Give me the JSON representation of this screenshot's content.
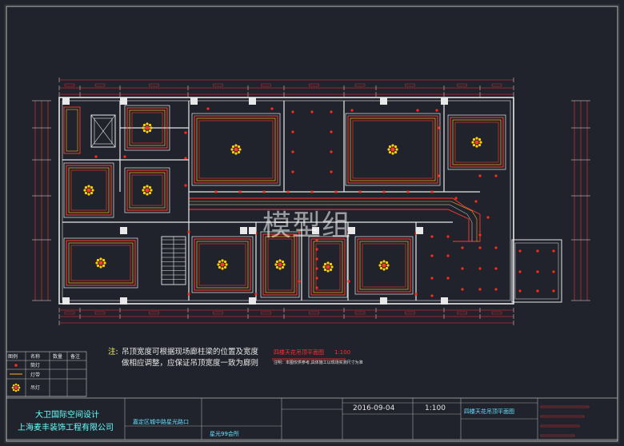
{
  "watermark": "模型组",
  "note": {
    "key": "注:",
    "line1": "吊顶宽度可根据现场廊柱梁的位置及宽度",
    "line2": "做相应调整，应保证吊顶宽度一致为廊则"
  },
  "plan_title": {
    "label": "四楼天花吊顶平面图",
    "scale": "1:100"
  },
  "plan_subnote": "注明：本图仅供参考,具体施工以现场实测尺寸为准",
  "legend": {
    "headers": [
      "图例",
      "名称",
      "数量",
      "备注"
    ],
    "rows": [
      {
        "name": "筒灯"
      },
      {
        "name": "灯带"
      },
      {
        "name": "吊灯"
      }
    ]
  },
  "title_block": {
    "company_cn": "大卫国际空间设计",
    "company_contractor": "上海麦丰装饰工程有限公司",
    "project": "嘉定区城中路星光路口",
    "sheet_name": "星光99会所",
    "date": "2016-09-04",
    "scale": "1:100",
    "drawing_title": "四楼天花吊顶平面图"
  },
  "colors": {
    "background": "#20232b",
    "wall": "#e8e8e8",
    "ceiling_outer": "#ff3b2f",
    "ceiling_inner": "#ffb020",
    "lamp": "#ffd000",
    "dimension": "#ff3030",
    "frame": "#bfbfbf",
    "downlight": "#ff2a1a"
  },
  "icons": [
    "chandelier-icon",
    "downlight-icon",
    "stair-icon",
    "elevator-icon"
  ]
}
